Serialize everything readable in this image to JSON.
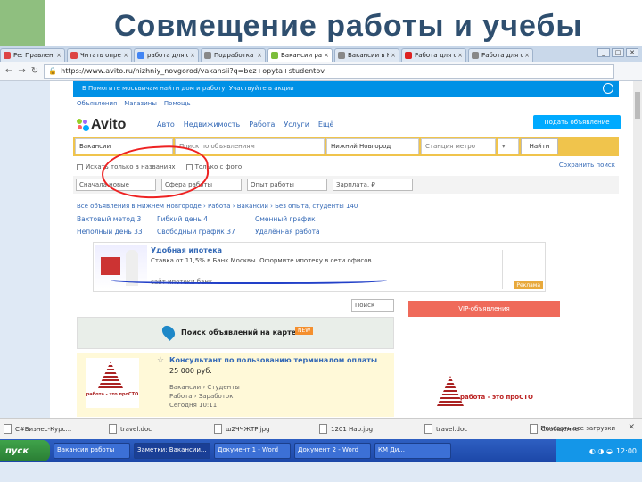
{
  "slide": {
    "title": "Совмещение работы и учебы"
  },
  "browser": {
    "tabs": [
      {
        "label": "Ре: Правление",
        "color": "#d44",
        "active": false
      },
      {
        "label": "Читать опред",
        "color": "#d44",
        "active": false
      },
      {
        "label": "работа для сту",
        "color": "#4285f4",
        "active": false
      },
      {
        "label": "Подработка Ст",
        "color": "#888",
        "active": false
      },
      {
        "label": "Вакансии работ",
        "color": "#7bbd3a",
        "active": true
      },
      {
        "label": "Вакансии в Ни",
        "color": "#888",
        "active": false
      },
      {
        "label": "Работа для сту",
        "color": "#d22",
        "active": false
      },
      {
        "label": "Работа для ст",
        "color": "#888",
        "active": false
      }
    ],
    "url": "https://www.avito.ru/nizhniy_novgorod/vakansii?q=bez+opyta+studentov",
    "url_secure": "https://",
    "window_controls": [
      "_",
      "□",
      "✕"
    ]
  },
  "avito": {
    "top_bar_text": "В  Помогите москвичам найти дом и работу. Участвуйте в акции",
    "mini_links": [
      "Объявления",
      "Магазины",
      "Помощь"
    ],
    "logo": "Avito",
    "categories": [
      "Авто",
      "Недвижимость",
      "Работа",
      "Услуги",
      "Ещё"
    ],
    "post_button": "Подать объявление",
    "search": {
      "category": "Вакансии",
      "query_placeholder": "Поиск по объявлениям",
      "city": "Нижний Новгород",
      "metro": "Станция метро",
      "find_button": "Найти"
    },
    "options": {
      "title_only": "Искать только в названиях",
      "with_photo": "Только с фото",
      "save_search": "Сохранить поиск"
    },
    "filters": [
      "Сначала новые",
      "Сфера работы",
      "Опыт работы",
      "Зарплата, ₽"
    ],
    "breadcrumb": "Все объявления в Нижнем Новгороде › Работа › Вакансии › Без опыта, студенты 140",
    "tags": [
      "Вахтовый метод 3",
      "Гибкий день 4",
      "Сменный график",
      "Неполный день 33",
      "Свободный график 37",
      "Удалённая работа"
    ],
    "ad": {
      "title": "Удобная ипотека",
      "text": "Ставка от 11,5% в Банк Москвы. Оформите ипотеку в сети офисов",
      "url": "сайт ипотеки банк",
      "badge": "Реклама"
    },
    "sort": "Поиск",
    "vip_header": "VIP-объявления",
    "map": {
      "text": "Поиск объявлений на карте",
      "badge": "NEW"
    },
    "listing": {
      "title": "Консультант по пользованию терминалом оплаты",
      "price": "25 000 руб.",
      "meta": [
        "Вакансии › Студенты",
        "Работа › Заработок",
        "Сегодня 10:11"
      ],
      "logo_text": "работа - это проСТО"
    },
    "vip_logo_text": "работа - это проСТО"
  },
  "downloads": {
    "items": [
      "C#Бизнес-Курс...",
      "travel.doc",
      "ш2ЧЧЖТР.jpg",
      "1201 Нар.jpg",
      "travel.doc",
      "Сообщение"
    ],
    "show_all": "Показать все загрузки",
    "close": "✕"
  },
  "taskbar": {
    "start": "пуск",
    "tasks": [
      "Вакансии работы",
      "Заметки: Вакансии...",
      "Документ 1 - Word",
      "Документ 2 - Word",
      "КМ Ди..."
    ],
    "tray_time": "12:00"
  }
}
